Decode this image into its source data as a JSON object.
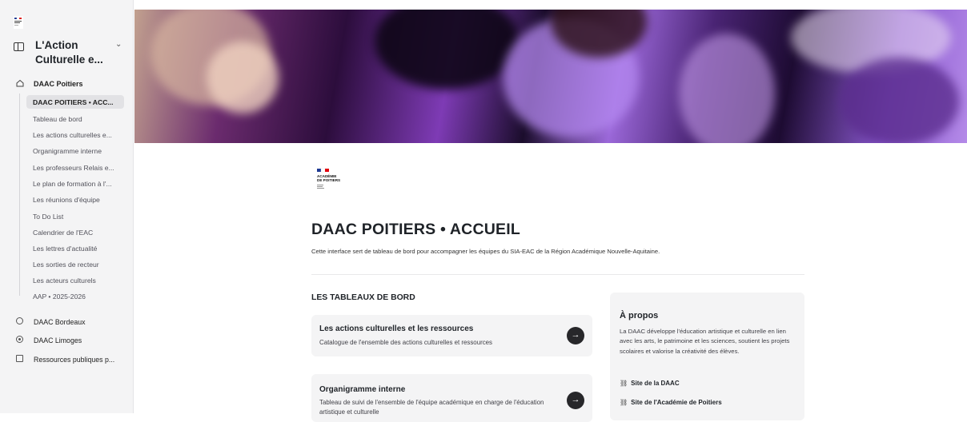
{
  "sidebar": {
    "workspace_title": "L'Action Culturelle e...",
    "home_label": "DAAC Poitiers",
    "sub_items": [
      "DAAC POITIERS • ACC...",
      "Tableau de bord",
      "Les actions culturelles e...",
      "Organigramme interne",
      "Les professeurs Relais e...",
      "Le plan de formation à l'...",
      "Les réunions d'équipe",
      "To Do List",
      "Calendrier de l'EAC",
      "Les lettres d'actualité",
      "Les sorties de recteur",
      "Les acteurs culturels",
      "AAP • 2025-2026"
    ],
    "groups": [
      "DAAC Bordeaux",
      "DAAC Limoges",
      "Ressources publiques p..."
    ]
  },
  "logo": {
    "line1": "ACADÉMIE",
    "line2": "DE POITIERS"
  },
  "main": {
    "title": "DAAC POITIERS • ACCUEIL",
    "subtitle": "Cette interface sert de tableau de bord pour accompagner les équipes du SIA-EAC de la Région Académique Nouvelle-Aquitaine.",
    "section_title": "LES TABLEAUX DE BORD",
    "cards": [
      {
        "title": "Les actions culturelles et les ressources",
        "desc": "Catalogue de l'ensemble des actions culturelles et ressources"
      },
      {
        "title": "Organigramme interne",
        "desc": "Tableau de suivi de l'ensemble de l'équipe académique en charge de l'éducation artistique et culturelle"
      }
    ]
  },
  "about": {
    "title": "À propos",
    "text": "La DAAC développe l'éducation artistique et culturelle en lien avec les arts, le patrimoine et les sciences, soutient les projets scolaires et valorise la créativité des élèves.",
    "links": [
      "Site de la DAAC",
      "Site de l'Académie de Poitiers"
    ]
  },
  "icons": {
    "arrow": "→",
    "chevron": "⌄",
    "link": "⛓"
  }
}
